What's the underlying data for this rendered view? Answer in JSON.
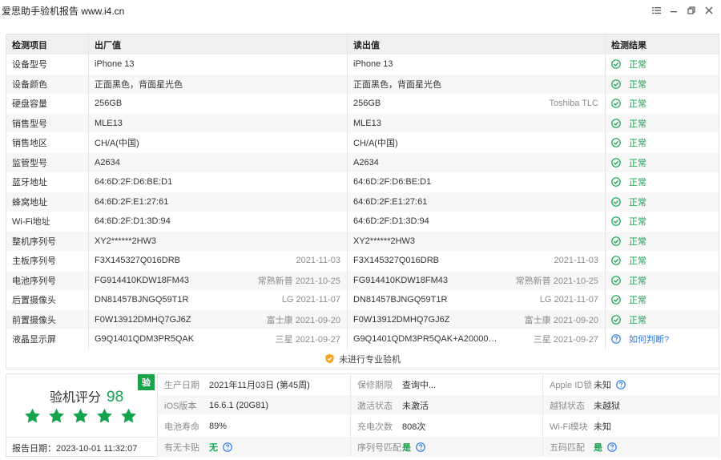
{
  "window": {
    "title": "爱思助手验机报告 www.i4.cn"
  },
  "table": {
    "headers": [
      "检测项目",
      "出厂值",
      "读出值",
      "检测结果"
    ],
    "rows": [
      {
        "item": "设备型号",
        "factory": "iPhone 13",
        "factory_note": "",
        "read": "iPhone 13",
        "read_note": "",
        "result": "正常",
        "status": "ok"
      },
      {
        "item": "设备颜色",
        "factory": "正面黑色，背面星光色",
        "factory_note": "",
        "read": "正面黑色，背面星光色",
        "read_note": "",
        "result": "正常",
        "status": "ok"
      },
      {
        "item": "硬盘容量",
        "factory": "256GB",
        "factory_note": "",
        "read": "256GB",
        "read_note": "Toshiba TLC",
        "result": "正常",
        "status": "ok"
      },
      {
        "item": "销售型号",
        "factory": "MLE13",
        "factory_note": "",
        "read": "MLE13",
        "read_note": "",
        "result": "正常",
        "status": "ok"
      },
      {
        "item": "销售地区",
        "factory": "CH/A(中国)",
        "factory_note": "",
        "read": "CH/A(中国)",
        "read_note": "",
        "result": "正常",
        "status": "ok"
      },
      {
        "item": "监管型号",
        "factory": "A2634",
        "factory_note": "",
        "read": "A2634",
        "read_note": "",
        "result": "正常",
        "status": "ok"
      },
      {
        "item": "蓝牙地址",
        "factory": "64:6D:2F:D6:BE:D1",
        "factory_note": "",
        "read": "64:6D:2F:D6:BE:D1",
        "read_note": "",
        "result": "正常",
        "status": "ok"
      },
      {
        "item": "蜂窝地址",
        "factory": "64:6D:2F:E1:27:61",
        "factory_note": "",
        "read": "64:6D:2F:E1:27:61",
        "read_note": "",
        "result": "正常",
        "status": "ok"
      },
      {
        "item": "Wi-Fi地址",
        "factory": "64:6D:2F:D1:3D:94",
        "factory_note": "",
        "read": "64:6D:2F:D1:3D:94",
        "read_note": "",
        "result": "正常",
        "status": "ok"
      },
      {
        "item": "整机序列号",
        "factory": "XY2******2HW3",
        "factory_note": "",
        "read": "XY2******2HW3",
        "read_note": "",
        "result": "正常",
        "status": "ok"
      },
      {
        "item": "主板序列号",
        "factory": "F3X145327Q016DRB",
        "factory_note": "2021-11-03",
        "read": "F3X145327Q016DRB",
        "read_note": "2021-11-03",
        "result": "正常",
        "status": "ok"
      },
      {
        "item": "电池序列号",
        "factory": "FG914410KDW18FM43",
        "factory_note": "常熟新普 2021-10-25",
        "read": "FG914410KDW18FM43",
        "read_note": "常熟新普 2021-10-25",
        "result": "正常",
        "status": "ok"
      },
      {
        "item": "后置摄像头",
        "factory": "DN81457BJNGQ59T1R",
        "factory_note": "LG 2021-11-07",
        "read": "DN81457BJNGQ59T1R",
        "read_note": "LG 2021-11-07",
        "result": "正常",
        "status": "ok"
      },
      {
        "item": "前置摄像头",
        "factory": "F0W13912DMHQ7GJ6Z",
        "factory_note": "富士康 2021-09-20",
        "read": "F0W13912DMHQ7GJ6Z",
        "read_note": "富士康 2021-09-20",
        "result": "正常",
        "status": "ok"
      },
      {
        "item": "液晶显示屏",
        "factory": "G9Q1401QDM3PR5QAK",
        "factory_note": "三星 2021-09-27",
        "read": "G9Q1401QDM3PR5QAK+A200000...",
        "read_note": "三星 2021-09-27",
        "result": "如何判断?",
        "status": "question"
      }
    ],
    "footer_text": "未进行专业验机"
  },
  "summary": {
    "score_label": "验机评分",
    "score": "98",
    "stars": 5,
    "badge": "验",
    "report_date": "报告日期：2023-10-01 11:32:07",
    "grid": [
      [
        {
          "label": "生产日期",
          "value": "2021年11月03日 (第45周)"
        },
        {
          "label": "保修期限",
          "value": "查询中..."
        },
        {
          "label": "Apple ID锁",
          "value": "未知",
          "help": true
        }
      ],
      [
        {
          "label": "iOS版本",
          "value": "16.6.1 (20G81)"
        },
        {
          "label": "激活状态",
          "value": "未激活"
        },
        {
          "label": "越狱状态",
          "value": "未越狱"
        }
      ],
      [
        {
          "label": "电池寿命",
          "value": "89%"
        },
        {
          "label": "充电次数",
          "value": "808次"
        },
        {
          "label": "Wi-Fi模块",
          "value": "未知"
        }
      ],
      [
        {
          "label": "有无卡贴",
          "value": "无",
          "green": true,
          "help": true
        },
        {
          "label": "序列号匹配",
          "value": "是",
          "green": true,
          "help": true
        },
        {
          "label": "五码匹配",
          "value": "是",
          "green": true,
          "help": true
        }
      ]
    ]
  },
  "colors": {
    "ok": "#14a44d",
    "link": "#2f7ae5",
    "badge": "#1aa34a",
    "muted": "#8c8c8c",
    "header_bg": "#f0f0f0"
  }
}
